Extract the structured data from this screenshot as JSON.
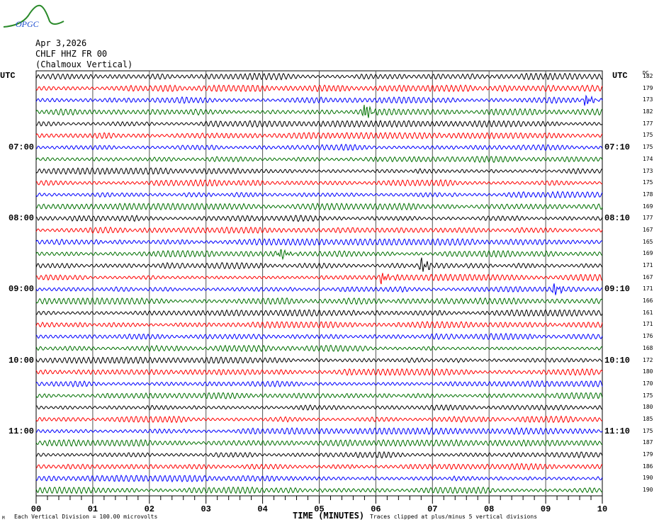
{
  "logo": {
    "text": "OPGC"
  },
  "header": {
    "date": "Apr 3,2026",
    "station": "CHLF HHZ FR 00",
    "description": "(Chalmoux Vertical)"
  },
  "left_axis": {
    "title": "UTC"
  },
  "right_axis": {
    "title": "UTC",
    "dc_title": "DC"
  },
  "footer": {
    "scale_note": "Each Vertical Division =  100.00 microvolts",
    "xlabel": "TIME (MINUTES)",
    "clip_note": "Traces clipped at plus/minus 5 vertical divisions",
    "corner_mark": "M"
  },
  "colors": [
    "#000000",
    "#ff0000",
    "#0000ff",
    "#007000"
  ],
  "chart_data": {
    "type": "line",
    "title": "CHLF HHZ FR 00 helicorder",
    "xlabel": "TIME (MINUTES)",
    "xlim": [
      0,
      10
    ],
    "x_ticks": [
      "00",
      "01",
      "02",
      "03",
      "04",
      "05",
      "06",
      "07",
      "08",
      "09",
      "10"
    ],
    "left_time_labels": [
      {
        "row": 6,
        "label": "07:00"
      },
      {
        "row": 12,
        "label": "08:00"
      },
      {
        "row": 18,
        "label": "09:00"
      },
      {
        "row": 24,
        "label": "10:00"
      },
      {
        "row": 30,
        "label": "11:00"
      }
    ],
    "right_time_labels": [
      {
        "row": 6,
        "label": "07:10"
      },
      {
        "row": 12,
        "label": "08:10"
      },
      {
        "row": 18,
        "label": "09:10"
      },
      {
        "row": 24,
        "label": "10:10"
      },
      {
        "row": 30,
        "label": "11:10"
      }
    ],
    "row_dc_offsets": [
      182,
      179,
      173,
      182,
      177,
      175,
      175,
      174,
      173,
      175,
      178,
      169,
      177,
      167,
      165,
      169,
      171,
      167,
      171,
      166,
      161,
      171,
      176,
      168,
      172,
      180,
      170,
      175,
      180,
      185,
      175,
      187,
      179,
      186,
      190,
      190
    ],
    "events": [
      {
        "row": 2,
        "minute": 9.7,
        "amp": 1.8
      },
      {
        "row": 3,
        "minute": 5.8,
        "amp": 2.4
      },
      {
        "row": 15,
        "minute": 4.3,
        "amp": 2.0
      },
      {
        "row": 16,
        "minute": 6.8,
        "amp": 2.2
      },
      {
        "row": 17,
        "minute": 6.1,
        "amp": 1.7
      },
      {
        "row": 18,
        "minute": 9.15,
        "amp": 1.5
      }
    ]
  }
}
